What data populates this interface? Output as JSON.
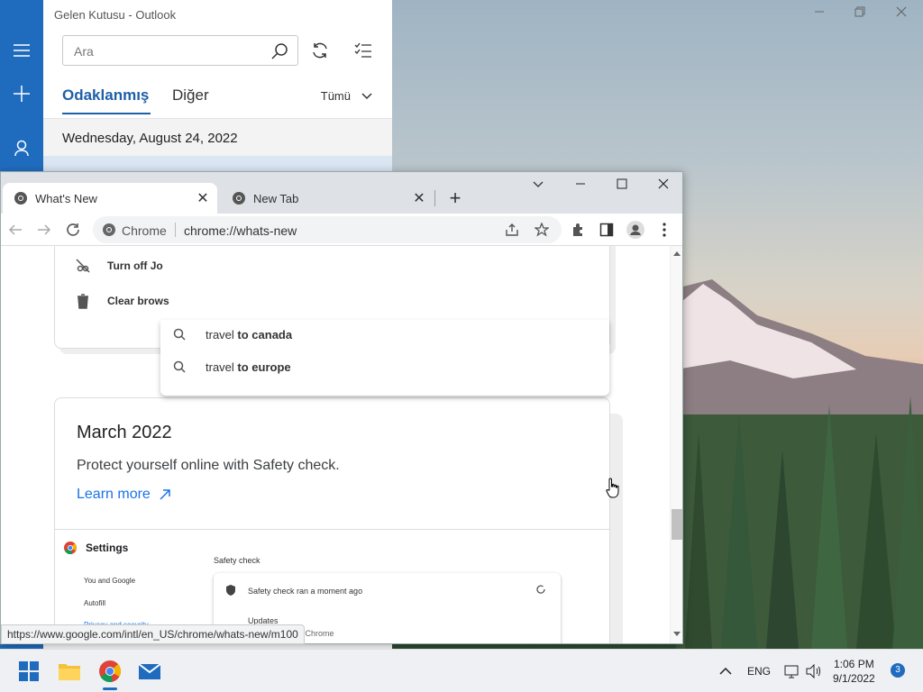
{
  "outlook": {
    "title": "Gelen Kutusu - Outlook",
    "search_placeholder": "Ara",
    "tabs": [
      {
        "label": "Odaklanmış",
        "active": true
      },
      {
        "label": "Diğer",
        "active": false
      }
    ],
    "filter_label": "Tümü",
    "date_header": "Wednesday, August 24, 2022",
    "rail_icons": [
      "menu-icon",
      "compose-icon",
      "people-icon"
    ],
    "accent_color": "#1f6cbf"
  },
  "chrome": {
    "tabs": [
      {
        "title": "What's New",
        "active": true
      },
      {
        "title": "New Tab",
        "active": false
      }
    ],
    "omnibox_chip": "Chrome",
    "url": "chrome://whats-new",
    "suggestions": [
      {
        "prefix": "travel ",
        "bold": "to canada"
      },
      {
        "prefix": "travel ",
        "bold": "to europe"
      }
    ],
    "partial_items": [
      "Turn off Jo",
      "Clear brows"
    ],
    "march": {
      "title": "March 2022",
      "description": "Protect yourself online with Safety check.",
      "learn_more": "Learn more"
    },
    "settings_shot": {
      "title": "Settings",
      "nav": [
        "You and Google",
        "Autofill",
        "Privacy and security"
      ],
      "section": "Safety check",
      "row1": "Safety check ran a moment ago",
      "row2_title": "Updates",
      "row2_sub": "atest version of Chrome"
    },
    "status_url": "https://www.google.com/intl/en_US/chrome/whats-new/m100"
  },
  "taskbar": {
    "apps": [
      "windows-start-icon",
      "file-explorer-icon",
      "chrome-icon",
      "mail-icon"
    ],
    "language": "ENG",
    "time": "1:06 PM",
    "date": "9/1/2022",
    "notification_count": "3"
  }
}
